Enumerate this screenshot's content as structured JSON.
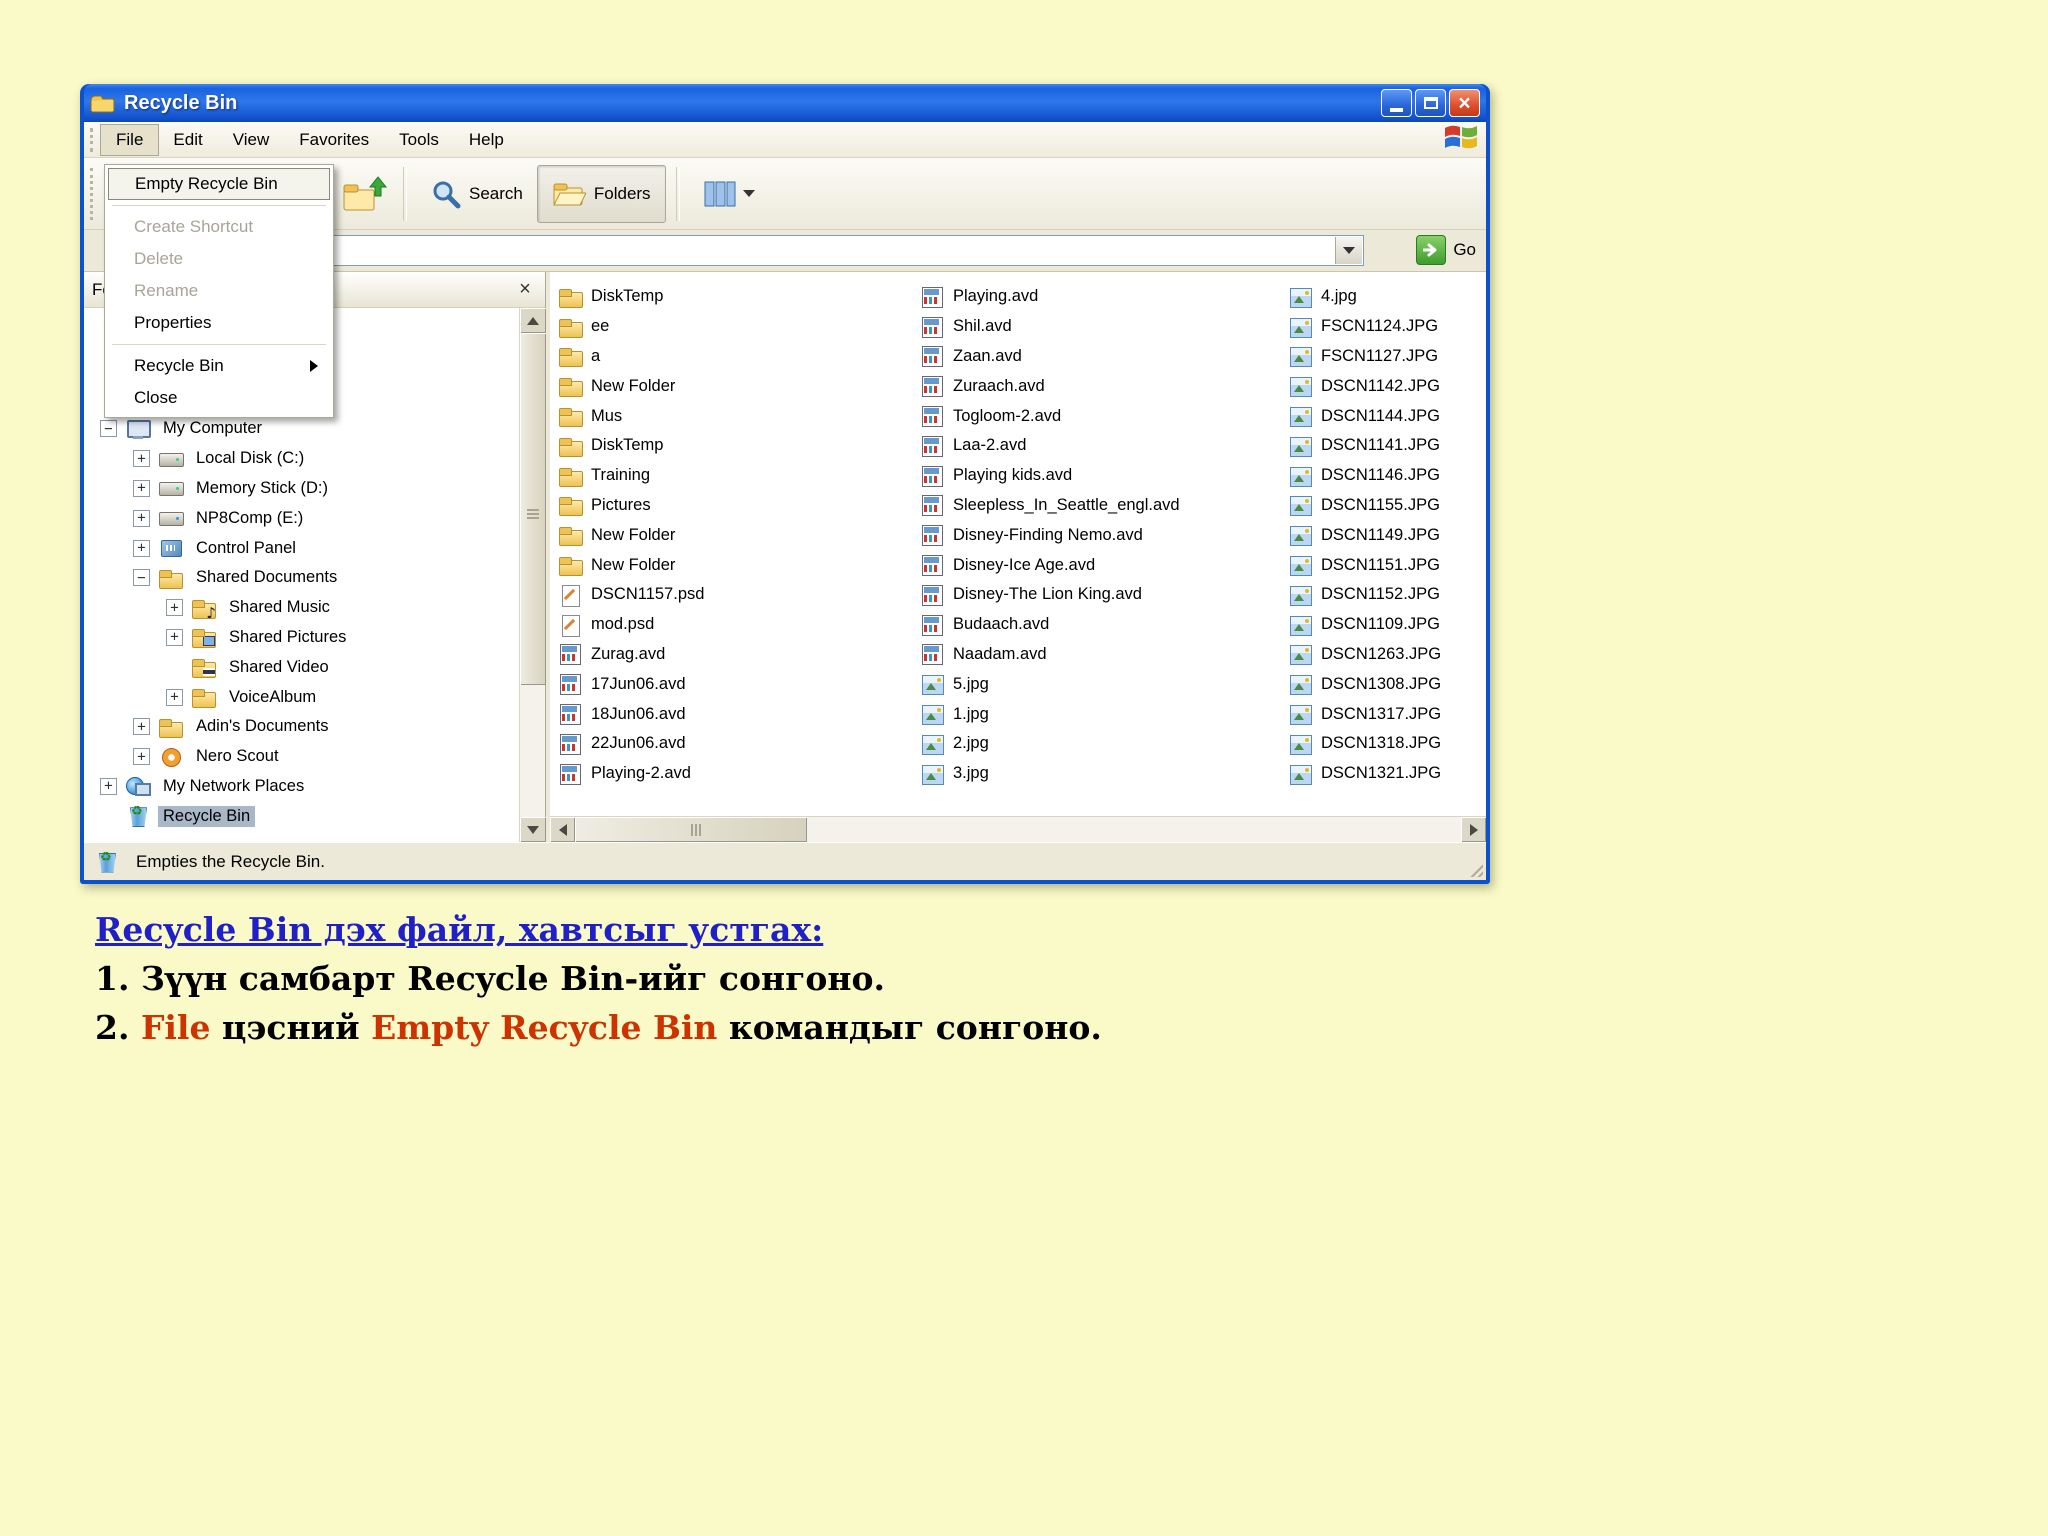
{
  "page": {
    "background": "#FAFAC8"
  },
  "window": {
    "title": "Recycle Bin",
    "menus": [
      {
        "label": "File",
        "active": true
      },
      {
        "label": "Edit"
      },
      {
        "label": "View"
      },
      {
        "label": "Favorites"
      },
      {
        "label": "Tools"
      },
      {
        "label": "Help"
      }
    ],
    "file_menu": [
      {
        "label": "Empty Recycle Bin",
        "highlight": true
      },
      {
        "sep": true
      },
      {
        "label": "Create Shortcut",
        "disabled": true
      },
      {
        "label": "Delete",
        "disabled": true
      },
      {
        "label": "Rename",
        "disabled": true
      },
      {
        "label": "Properties"
      },
      {
        "sep": true
      },
      {
        "label": "Recycle Bin",
        "submenu": true
      },
      {
        "label": "Close"
      }
    ],
    "toolbar": {
      "search_label": "Search",
      "folders_label": "Folders"
    },
    "address_bar": {
      "go_label": "Go"
    },
    "folders_pane": {
      "title": "Folders",
      "tree": [
        {
          "label": "My Computer",
          "level": 1,
          "expand": "minus",
          "icon": "computer"
        },
        {
          "label": "Local Disk (C:)",
          "level": 2,
          "expand": "plus",
          "icon": "drive"
        },
        {
          "label": "Memory Stick (D:)",
          "level": 2,
          "expand": "plus",
          "icon": "drive"
        },
        {
          "label": "NP8Comp (E:)",
          "level": 2,
          "expand": "plus",
          "icon": "drive-user"
        },
        {
          "label": "Control Panel",
          "level": 2,
          "expand": "plus",
          "icon": "control-panel"
        },
        {
          "label": "Shared Documents",
          "level": 2,
          "expand": "minus",
          "icon": "folder"
        },
        {
          "label": "Shared Music",
          "level": 3,
          "expand": "plus",
          "icon": "folder-music"
        },
        {
          "label": "Shared Pictures",
          "level": 3,
          "expand": "plus",
          "icon": "folder-pictures"
        },
        {
          "label": "Shared Video",
          "level": 3,
          "expand": "none",
          "icon": "folder-video"
        },
        {
          "label": "VoiceAlbum",
          "level": 3,
          "expand": "plus",
          "icon": "folder"
        },
        {
          "label": "Adin's Documents",
          "level": 2,
          "expand": "plus",
          "icon": "folder"
        },
        {
          "label": "Nero Scout",
          "level": 2,
          "expand": "plus",
          "icon": "nero"
        },
        {
          "label": "My Network Places",
          "level": 1,
          "expand": "plus",
          "icon": "network"
        },
        {
          "label": "Recycle Bin",
          "level": 1,
          "expand": "none",
          "icon": "recycle",
          "selected": true
        }
      ]
    },
    "files": {
      "columns": [
        [
          {
            "name": "DiskTemp",
            "type": "folder"
          },
          {
            "name": "ee",
            "type": "folder"
          },
          {
            "name": "a",
            "type": "folder"
          },
          {
            "name": "New Folder",
            "type": "folder"
          },
          {
            "name": "Mus",
            "type": "folder"
          },
          {
            "name": "DiskTemp",
            "type": "folder"
          },
          {
            "name": "Training",
            "type": "folder"
          },
          {
            "name": "Pictures",
            "type": "folder"
          },
          {
            "name": "New Folder",
            "type": "folder"
          },
          {
            "name": "New Folder",
            "type": "folder"
          },
          {
            "name": "DSCN1157.psd",
            "type": "psd"
          },
          {
            "name": "mod.psd",
            "type": "psd"
          },
          {
            "name": "Zurag.avd",
            "type": "avd"
          },
          {
            "name": "17Jun06.avd",
            "type": "avd"
          },
          {
            "name": "18Jun06.avd",
            "type": "avd"
          },
          {
            "name": "22Jun06.avd",
            "type": "avd"
          },
          {
            "name": "Playing-2.avd",
            "type": "avd"
          }
        ],
        [
          {
            "name": "Playing.avd",
            "type": "avd"
          },
          {
            "name": "Shil.avd",
            "type": "avd"
          },
          {
            "name": "Zaan.avd",
            "type": "avd"
          },
          {
            "name": "Zuraach.avd",
            "type": "avd"
          },
          {
            "name": "Togloom-2.avd",
            "type": "avd"
          },
          {
            "name": "Laa-2.avd",
            "type": "avd"
          },
          {
            "name": "Playing kids.avd",
            "type": "avd"
          },
          {
            "name": "Sleepless_In_Seattle_engl.avd",
            "type": "avd"
          },
          {
            "name": "Disney-Finding Nemo.avd",
            "type": "avd"
          },
          {
            "name": "Disney-Ice Age.avd",
            "type": "avd"
          },
          {
            "name": "Disney-The Lion King.avd",
            "type": "avd"
          },
          {
            "name": "Budaach.avd",
            "type": "avd"
          },
          {
            "name": "Naadam.avd",
            "type": "avd"
          },
          {
            "name": "5.jpg",
            "type": "jpg"
          },
          {
            "name": "1.jpg",
            "type": "jpg"
          },
          {
            "name": "2.jpg",
            "type": "jpg"
          },
          {
            "name": "3.jpg",
            "type": "jpg"
          }
        ],
        [
          {
            "name": "4.jpg",
            "type": "jpg"
          },
          {
            "name": "FSCN1124.JPG",
            "type": "jpg"
          },
          {
            "name": "FSCN1127.JPG",
            "type": "jpg"
          },
          {
            "name": "DSCN1142.JPG",
            "type": "jpg"
          },
          {
            "name": "DSCN1144.JPG",
            "type": "jpg"
          },
          {
            "name": "DSCN1141.JPG",
            "type": "jpg"
          },
          {
            "name": "DSCN1146.JPG",
            "type": "jpg"
          },
          {
            "name": "DSCN1155.JPG",
            "type": "jpg"
          },
          {
            "name": "DSCN1149.JPG",
            "type": "jpg"
          },
          {
            "name": "DSCN1151.JPG",
            "type": "jpg"
          },
          {
            "name": "DSCN1152.JPG",
            "type": "jpg"
          },
          {
            "name": "DSCN1109.JPG",
            "type": "jpg"
          },
          {
            "name": "DSCN1263.JPG",
            "type": "jpg"
          },
          {
            "name": "DSCN1308.JPG",
            "type": "jpg"
          },
          {
            "name": "DSCN1317.JPG",
            "type": "jpg"
          },
          {
            "name": "DSCN1318.JPG",
            "type": "jpg"
          },
          {
            "name": "DSCN1321.JPG",
            "type": "jpg"
          }
        ]
      ]
    },
    "status_bar": {
      "text": "Empties the Recycle Bin."
    }
  },
  "caption": {
    "heading": "Recycle Bin дэх файл, хавтсыг устгах:",
    "line1": "1. Зүүн самбарт Recycle Bin-ийг сонгоно.",
    "line2_parts": [
      {
        "text": "2. "
      },
      {
        "text": "File",
        "style": "red"
      },
      {
        "text": " цэсний "
      },
      {
        "text": "Empty Recycle Bin",
        "style": "red"
      },
      {
        "text": " командыг сонгоно."
      }
    ],
    "colors": {
      "heading": "#2020C8",
      "red": "#CC3300"
    }
  }
}
